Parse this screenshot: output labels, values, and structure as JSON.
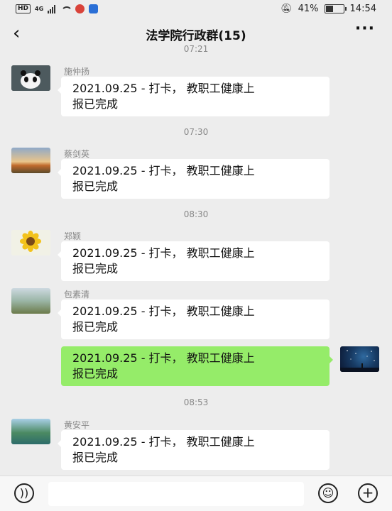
{
  "status_bar": {
    "network_badge": "HD",
    "network_type": "4G",
    "battery_percent": "41%",
    "battery_level": 0.41,
    "clock": "14:54",
    "icons": [
      "signal-icon",
      "wifi-icon",
      "app-notification-icon",
      "shield-icon",
      "mute-icon",
      "battery-icon"
    ]
  },
  "nav": {
    "back_icon": "‹",
    "title": "法学院行政群(15)",
    "more_icon": "···"
  },
  "chat": {
    "timestamps": {
      "t1": "07:21",
      "t2": "07:30",
      "t3": "08:30",
      "t4": "08:53"
    },
    "messages": [
      {
        "sender": "施仲扬",
        "text_line1": "2021.09.25 - 打卡， 教职工健康上",
        "text_line2": "报已完成"
      },
      {
        "sender": "蔡剑英",
        "text_line1": "2021.09.25 - 打卡， 教职工健康上",
        "text_line2": "报已完成"
      },
      {
        "sender": "郑颖",
        "text_line1": "2021.09.25 - 打卡， 教职工健康上",
        "text_line2": "报已完成"
      },
      {
        "sender": "包素清",
        "text_line1": "2021.09.25 - 打卡， 教职工健康上",
        "text_line2": "报已完成"
      },
      {
        "sender": "",
        "text_line1": "2021.09.25 - 打卡， 教职工健康上",
        "text_line2": "报已完成"
      },
      {
        "sender": "黄安平",
        "text_line1": "2021.09.25 - 打卡， 教职工健康上",
        "text_line2": "报已完成"
      }
    ]
  },
  "input_bar": {
    "voice_icon": "))",
    "emoji_icon": "☺",
    "plus_icon": "+"
  },
  "colors": {
    "background": "#ededed",
    "incoming_bubble": "#ffffff",
    "outgoing_bubble": "#95ec69",
    "secondary_text": "#888888"
  }
}
